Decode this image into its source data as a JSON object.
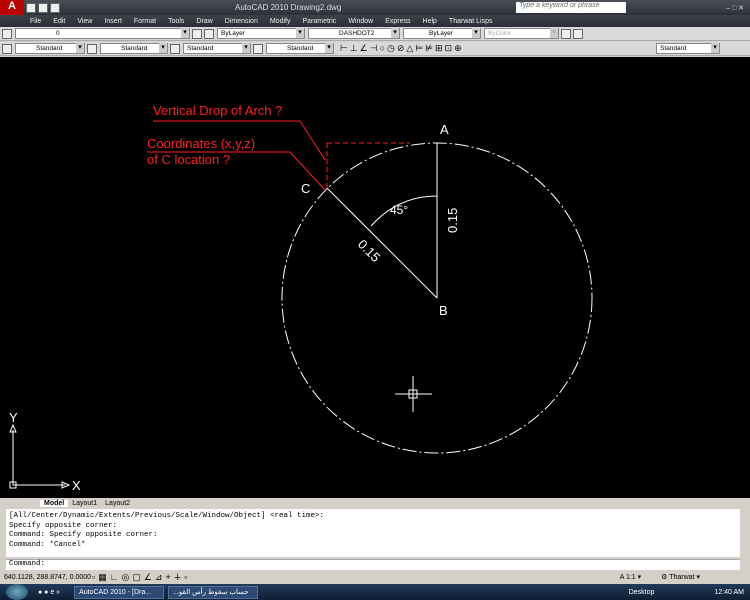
{
  "window": {
    "title": "AutoCAD 2010    Drawing2.dwg",
    "search_placeholder": "Type a keyword or phrase"
  },
  "menu": [
    "File",
    "Edit",
    "View",
    "Insert",
    "Format",
    "Tools",
    "Draw",
    "Dimension",
    "Modify",
    "Parametric",
    "Window",
    "Express",
    "Help",
    "Tharwat Lisps"
  ],
  "toolbar": {
    "layer": "0",
    "color": "ByLayer",
    "linetype": "DASHDOT2",
    "lineweight": "ByLayer",
    "plotstyle": "ByColor",
    "text_style": "Standard",
    "dim_style": "Standard",
    "table_style": "Standard",
    "mleader_style": "Standard",
    "style5": "Standard"
  },
  "drawing": {
    "annotation1": "Vertical Drop of Arch ?",
    "annotation2_line1": "Coordinates (x,y,z)",
    "annotation2_line2": "of C location ?",
    "point_a": "A",
    "point_b": "B",
    "point_c": "C",
    "angle": "45°",
    "dim_vertical": "0.15",
    "dim_diag": "0.15",
    "ucs_y": "Y",
    "ucs_x": "X",
    "colors": {
      "annotation": "#ff2020",
      "geometry": "#ffffff"
    }
  },
  "tabs": [
    "Model",
    "Layout1",
    "Layout2"
  ],
  "command": {
    "history": [
      "[All/Center/Dynamic/Extents/Previous/Scale/Window/Object] <real time>:",
      "Specify opposite corner:",
      "Command: Specify opposite corner:",
      "Command: *Cancel*"
    ],
    "prompt": "Command:"
  },
  "status": {
    "coords": "640.1128, 288.8747, 0.0000",
    "scale": "1:1",
    "workspace": "Tharwat"
  },
  "taskbar": {
    "task1": "AutoCAD 2010 - [Dra...",
    "task2": "...حساب سقوط رأس القو",
    "desktop": "Desktop",
    "time": "12:40 AM"
  }
}
